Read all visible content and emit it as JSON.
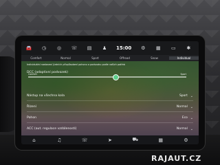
{
  "watermark": "RAJAUT.CZ",
  "topbar": {
    "time": "15:00",
    "icons": [
      "car-icon",
      "clock-icon",
      "globe-icon",
      "phone-icon",
      "document-icon",
      "driver-icon",
      "settings-icon",
      "grid-icon",
      "bluetooth-icon"
    ]
  },
  "modes": [
    {
      "label": "Comfort",
      "active": false
    },
    {
      "label": "Normal",
      "active": false
    },
    {
      "label": "Sport",
      "active": false
    },
    {
      "label": "Offroad",
      "active": false
    },
    {
      "label": "Snow",
      "active": false
    },
    {
      "label": "Individual",
      "active": true
    }
  ],
  "description": "Individuální nastavení jízdních přizpůsobení pohonu a podvozku podle vašich potřeb",
  "dcc": {
    "label": "DCC (adaptivní podvozek)",
    "left_label": "Comfort",
    "right_label": "Sport",
    "level": 0.55
  },
  "settings": [
    {
      "label": "Nástup na všechna kola",
      "value": "Sport"
    },
    {
      "label": "Řízení",
      "value": "Normal"
    },
    {
      "label": "Pohon",
      "value": "Eco"
    },
    {
      "label": "ACC (aut. regulace vzdálenosti)",
      "value": "Normal"
    }
  ],
  "bottombar": {
    "icons": [
      "home-icon",
      "music-icon",
      "phone-icon",
      "navigation-icon",
      "car-icon",
      "apps-icon",
      "settings-icon"
    ]
  }
}
